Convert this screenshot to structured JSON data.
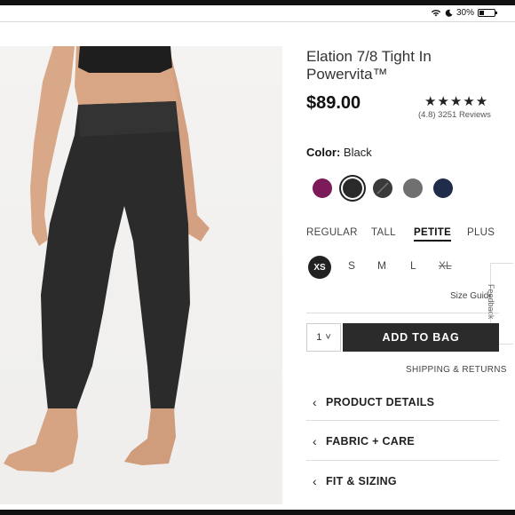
{
  "status": {
    "battery": "30%",
    "battery_level": 0.3
  },
  "product": {
    "title": "Elation 7/8 Tight In Powervita™",
    "price": "$89.00",
    "stars": "★★★★★",
    "rating": 4.8,
    "reviews_text": "(4.8) 3251 Reviews"
  },
  "color": {
    "label": "Color:",
    "value": "Black",
    "swatches": [
      {
        "name": "purple",
        "hex": "#7d1a5a"
      },
      {
        "name": "black",
        "hex": "#2a2a2a"
      },
      {
        "name": "black-heather",
        "hex": "#3a3a3a"
      },
      {
        "name": "grey",
        "hex": "#707070"
      },
      {
        "name": "navy",
        "hex": "#1f2d4a"
      }
    ]
  },
  "fits": [
    "REGULAR",
    "TALL",
    "PETITE",
    "PLUS"
  ],
  "sizes": [
    "XS",
    "S",
    "M",
    "L",
    "XL"
  ],
  "size_guide": "Size Guide",
  "feedback": "Feedback",
  "qty": {
    "value": "1",
    "chevron": "˅"
  },
  "add_to_bag": "ADD TO BAG",
  "shipping": "SHIPPING & RETURNS",
  "accordions": [
    "PRODUCT DETAILS",
    "FABRIC + CARE",
    "FIT & SIZING"
  ],
  "accordion_chevron": "‹"
}
